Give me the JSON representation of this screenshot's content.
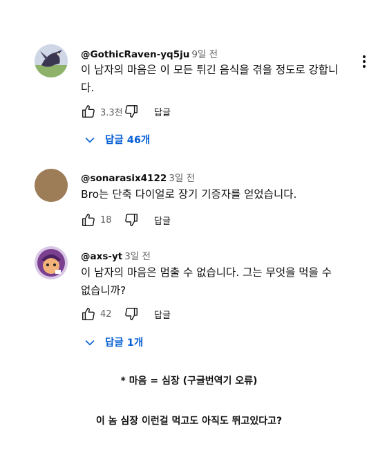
{
  "comments": [
    {
      "handle": "@GothicRaven-yq5ju",
      "date": "9일 전",
      "text": "이 남자의 마음은 이 모든 튀긴 음식을 겪을 정도로 강합니다.",
      "likes": "3.3천",
      "reply_label": "답글",
      "replies_label": "답글 46개"
    },
    {
      "handle": "@sonarasix4122",
      "date": "3일 전",
      "text": "Bro는 단축 다이얼로 장기 기증자를 얻었습니다.",
      "likes": "18",
      "reply_label": "답글"
    },
    {
      "handle": "@axs-yt",
      "date": "3일 전",
      "text": "이 남자의 마음은 멈출 수 없습니다. 그는 무엇을 먹을 수 없습니까?",
      "likes": "42",
      "reply_label": "답글",
      "replies_label": "답글 1개"
    }
  ],
  "notes": {
    "line1": "* 마음 = 심장 (구글번역기 오류)",
    "line2": "이 놈 심장 이런걸 먹고도 아직도 뛰고있다고?"
  },
  "icons": {
    "like": "thumbs-up-icon",
    "dislike": "thumbs-down-icon",
    "expand": "chevron-down-icon",
    "menu": "more-vert-icon"
  },
  "colors": {
    "link_blue": "#065fd4",
    "secondary_text": "#606060"
  }
}
